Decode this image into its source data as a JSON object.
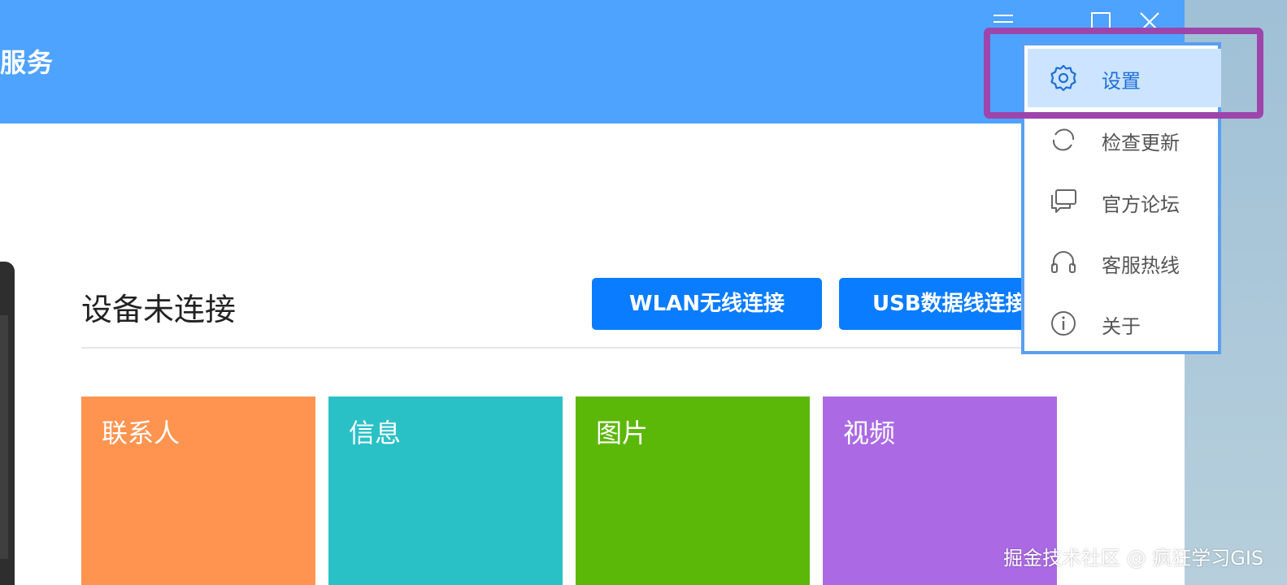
{
  "app": {
    "title": "服务"
  },
  "window_controls": {
    "menu_icon": "hamburger-menu-icon",
    "minimize_icon": "minimize-icon",
    "maximize_icon": "maximize-icon",
    "close_icon": "close-icon"
  },
  "device": {
    "status": "设备未连接",
    "connect_buttons": [
      {
        "label": "WLAN无线连接"
      },
      {
        "label": "USB数据线连接"
      }
    ]
  },
  "tiles": [
    {
      "label": "联系人",
      "color": "#ff9450"
    },
    {
      "label": "信息",
      "color": "#29c1c6"
    },
    {
      "label": "图片",
      "color": "#5bb808"
    },
    {
      "label": "视频",
      "color": "#ab6ae4"
    }
  ],
  "menu": {
    "items": [
      {
        "label": "设置",
        "icon": "gear-icon",
        "selected": true
      },
      {
        "label": "检查更新",
        "icon": "refresh-icon"
      },
      {
        "label": "官方论坛",
        "icon": "chat-bubbles-icon"
      },
      {
        "label": "客服热线",
        "icon": "headset-icon"
      },
      {
        "label": "关于",
        "icon": "info-icon"
      }
    ]
  },
  "colors": {
    "title_bar": "#4da3ff",
    "primary_button": "#0a7cff",
    "highlight": "#9e45ab",
    "menu_selected": "#cce4ff"
  },
  "watermark": "掘金技术社区 @ 疯狂学习GIS"
}
